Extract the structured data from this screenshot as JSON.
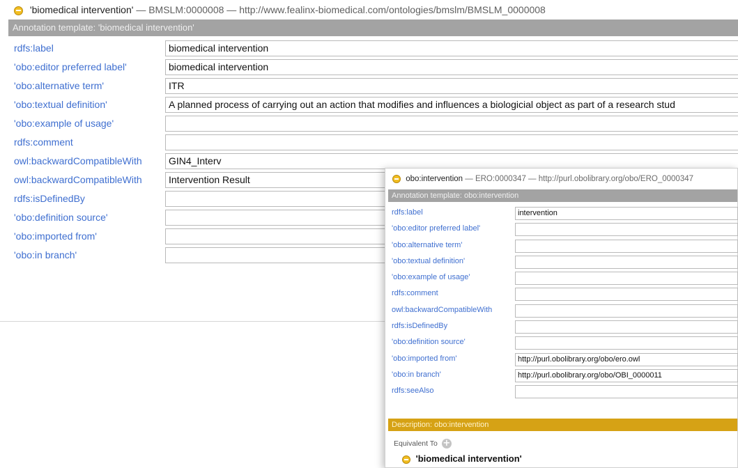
{
  "main": {
    "title": {
      "name": "'biomedical intervention'",
      "separator": "—",
      "id": "BMSLM:0000008",
      "iri": "http://www.fealinx-biomedical.com/ontologies/bmslm/BMSLM_0000008"
    },
    "template_header": "Annotation template: 'biomedical intervention'",
    "rows": [
      {
        "label": "rdfs:label",
        "value": "biomedical intervention"
      },
      {
        "label": "'obo:editor preferred label'",
        "value": "biomedical intervention"
      },
      {
        "label": "'obo:alternative term'",
        "value": "ITR"
      },
      {
        "label": "'obo:textual definition'",
        "value": "A planned process of carrying out an action that modifies and influences a biologicial object as part of a research stud"
      },
      {
        "label": "'obo:example of usage'",
        "value": ""
      },
      {
        "label": "rdfs:comment",
        "value": ""
      },
      {
        "label": "owl:backwardCompatibleWith",
        "value": "GIN4_Interv"
      },
      {
        "label": "owl:backwardCompatibleWith",
        "value": "Intervention Result"
      },
      {
        "label": "rdfs:isDefinedBy",
        "value": ""
      },
      {
        "label": "'obo:definition source'",
        "value": ""
      },
      {
        "label": "'obo:imported from'",
        "value": ""
      },
      {
        "label": "'obo:in branch'",
        "value": ""
      }
    ]
  },
  "overlay": {
    "title": {
      "name": "obo:intervention",
      "separator": "—",
      "id": "ERO:0000347",
      "iri": "http://purl.obolibrary.org/obo/ERO_0000347"
    },
    "template_header": "Annotation template: obo:intervention",
    "rows": [
      {
        "label": "rdfs:label",
        "value": "intervention"
      },
      {
        "label": "'obo:editor preferred label'",
        "value": ""
      },
      {
        "label": "'obo:alternative term'",
        "value": ""
      },
      {
        "label": "'obo:textual definition'",
        "value": ""
      },
      {
        "label": "'obo:example of usage'",
        "value": ""
      },
      {
        "label": "rdfs:comment",
        "value": ""
      },
      {
        "label": "owl:backwardCompatibleWith",
        "value": ""
      },
      {
        "label": "rdfs:isDefinedBy",
        "value": ""
      },
      {
        "label": "'obo:definition source'",
        "value": ""
      },
      {
        "label": "'obo:imported from'",
        "value": "http://purl.obolibrary.org/obo/ero.owl"
      },
      {
        "label": "'obo:in branch'",
        "value": "http://purl.obolibrary.org/obo/OBI_0000011"
      },
      {
        "label": "rdfs:seeAlso",
        "value": ""
      }
    ],
    "description_header": "Description: obo:intervention",
    "equivalent_to_label": "Equivalent To",
    "equivalent_item": "'biomedical intervention'"
  },
  "icons": {
    "class_icon": "class-circle-icon",
    "add_icon": "add-plus-icon"
  },
  "colors": {
    "class_icon": "#f2be22",
    "property_label": "#3f6fd0",
    "template_header_bg": "#a3a3a3",
    "description_header_bg": "#d6a215"
  }
}
